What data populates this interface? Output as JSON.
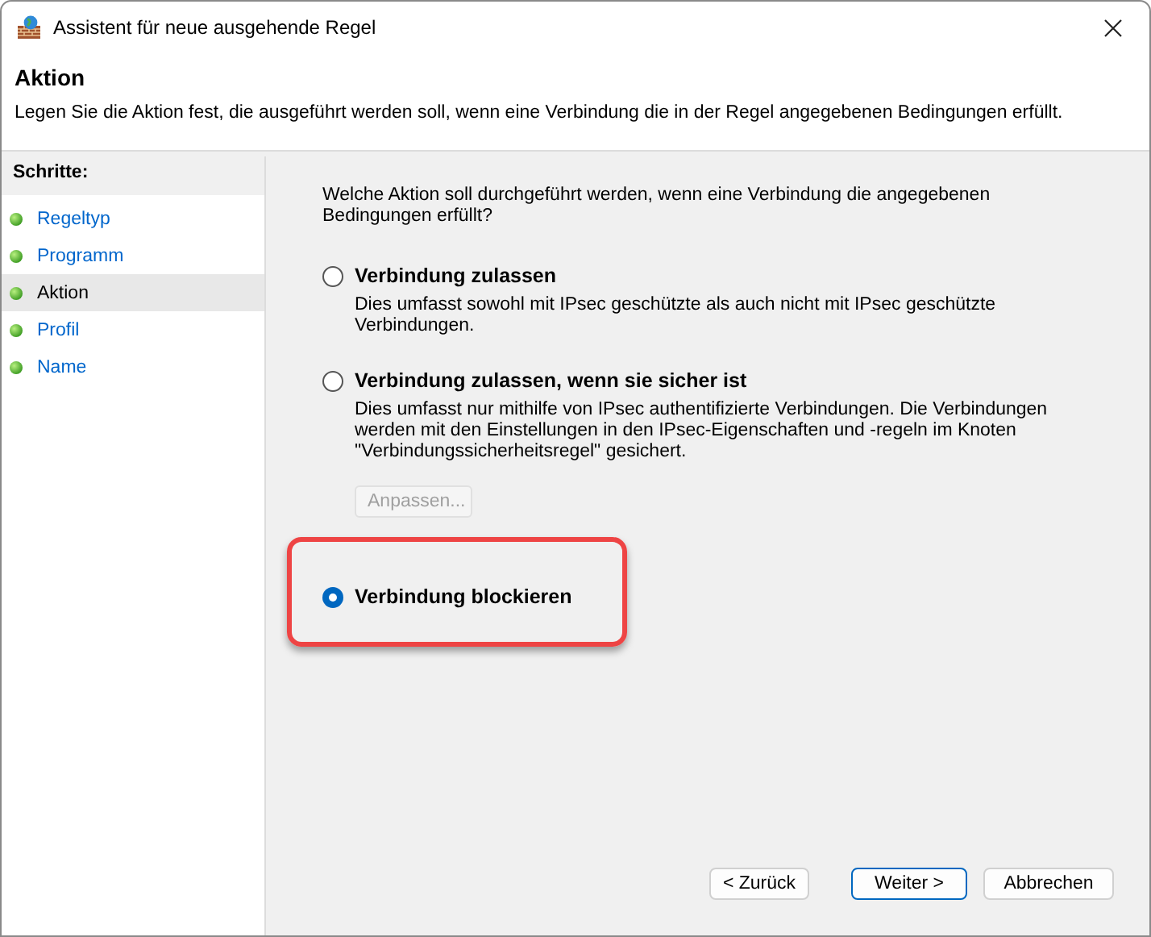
{
  "window": {
    "title": "Assistent für neue ausgehende Regel"
  },
  "header": {
    "title": "Aktion",
    "description": "Legen Sie die Aktion fest, die ausgeführt werden soll, wenn eine Verbindung die in der Regel angegebenen Bedingungen erfüllt."
  },
  "steps": {
    "title": "Schritte:",
    "items": [
      {
        "label": "Regeltyp",
        "selected": false
      },
      {
        "label": "Programm",
        "selected": false
      },
      {
        "label": "Aktion",
        "selected": true
      },
      {
        "label": "Profil",
        "selected": false
      },
      {
        "label": "Name",
        "selected": false
      }
    ]
  },
  "question": "Welche Aktion soll durchgeführt werden, wenn eine Verbindung die angegebenen Bedingungen erfüllt?",
  "options": [
    {
      "label": "Verbindung zulassen",
      "description": "Dies umfasst sowohl mit IPsec geschützte als auch nicht mit IPsec geschützte Verbindungen.",
      "selected": false
    },
    {
      "label": "Verbindung zulassen, wenn sie sicher ist",
      "description": "Dies umfasst nur mithilfe von IPsec authentifizierte Verbindungen. Die Verbindungen werden mit den Einstellungen in den IPsec-Eigenschaften und -regeln im Knoten \"Verbindungssicherheitsregel\" gesichert.",
      "selected": false,
      "button": {
        "label": "Anpassen...",
        "disabled": true
      }
    },
    {
      "label": "Verbindung blockieren",
      "selected": true
    }
  ],
  "buttons": [
    {
      "label": "< Zurück",
      "default": false
    },
    {
      "label": "Weiter >",
      "default": true
    },
    {
      "label": "Abbrechen",
      "default": false
    }
  ]
}
